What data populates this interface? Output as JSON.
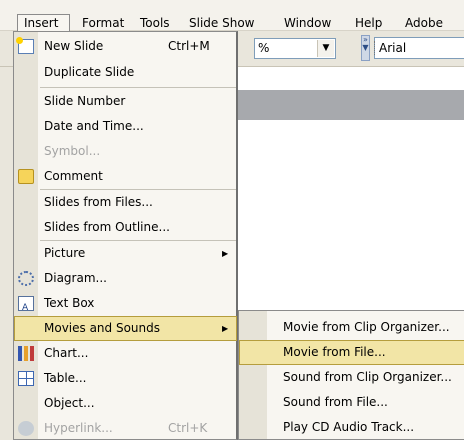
{
  "menubar": {
    "items": [
      {
        "label": "Insert"
      },
      {
        "label": "Format"
      },
      {
        "label": "Tools"
      },
      {
        "label": "Slide Show"
      },
      {
        "label": "Window"
      },
      {
        "label": "Help"
      },
      {
        "label": "Adobe"
      }
    ]
  },
  "toolbar": {
    "zoom_suffix": "%",
    "dropdown_glyph": "▼",
    "font_name": "Arial",
    "grip_glyph": "» ▼"
  },
  "insert_menu": {
    "items": [
      {
        "label": "New Slide",
        "shortcut": "Ctrl+M",
        "icon": "new-slide-icon"
      },
      {
        "label": "Duplicate Slide"
      },
      {
        "label": "Slide Number"
      },
      {
        "label": "Date and Time..."
      },
      {
        "label": "Symbol...",
        "disabled": true
      },
      {
        "label": "Comment",
        "icon": "comment-icon"
      },
      {
        "label": "Slides from Files..."
      },
      {
        "label": "Slides from Outline..."
      },
      {
        "label": "Picture",
        "submenu": true
      },
      {
        "label": "Diagram...",
        "icon": "diagram-icon"
      },
      {
        "label": "Text Box",
        "icon": "text-box-icon"
      },
      {
        "label": "Movies and Sounds",
        "submenu": true,
        "highlighted": true
      },
      {
        "label": "Chart...",
        "icon": "chart-icon"
      },
      {
        "label": "Table...",
        "icon": "table-icon"
      },
      {
        "label": "Object..."
      },
      {
        "label": "Hyperlink...",
        "shortcut": "Ctrl+K",
        "disabled": true,
        "icon": "hyperlink-icon"
      }
    ],
    "submenu_arrow": "▶"
  },
  "movies_submenu": {
    "items": [
      {
        "label": "Movie from Clip Organizer..."
      },
      {
        "label": "Movie from File...",
        "highlighted": true
      },
      {
        "label": "Sound from Clip Organizer..."
      },
      {
        "label": "Sound from File..."
      },
      {
        "label": "Play CD Audio Track..."
      }
    ]
  },
  "colors": {
    "highlight": "#f2e5a6",
    "highlight_border": "#b59d3d",
    "menu_bg": "#f8f6f1",
    "gutter": "#e6e3d8",
    "disabled_text": "#a3a3a3"
  }
}
